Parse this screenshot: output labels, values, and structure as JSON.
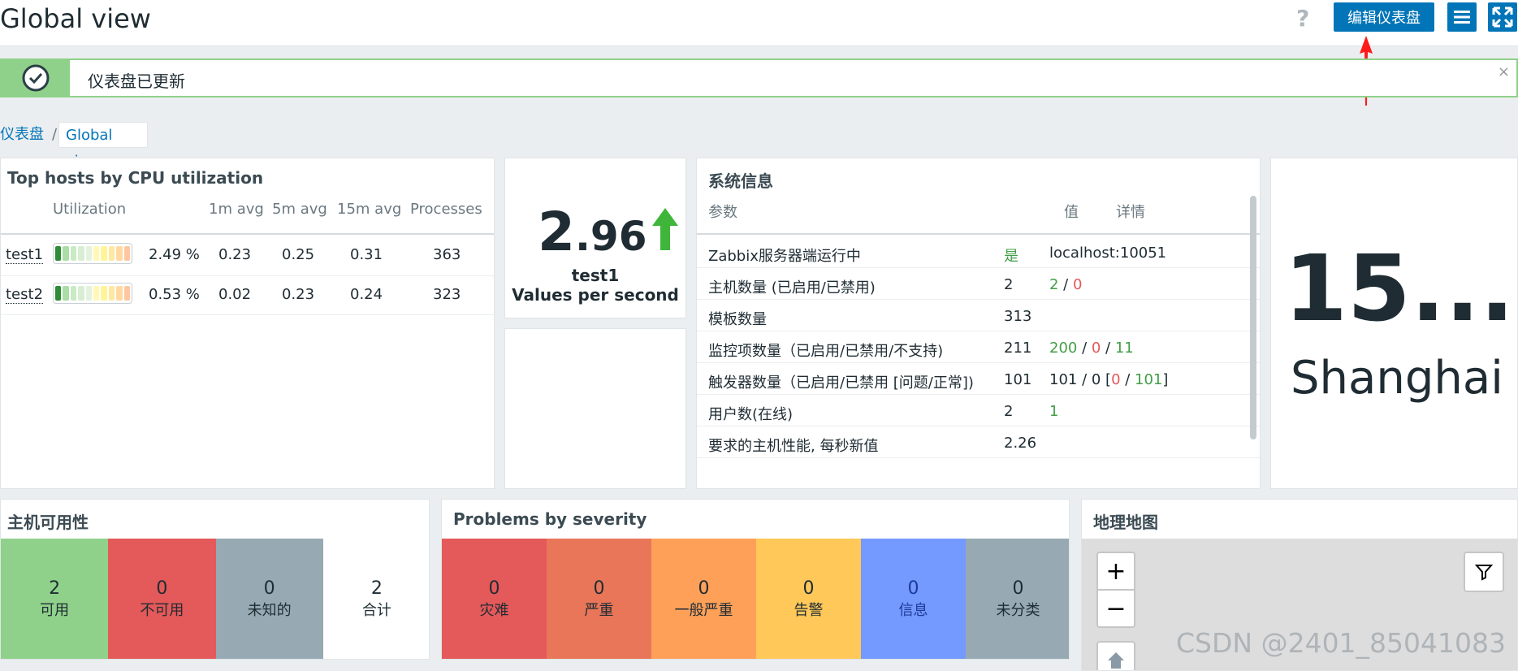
{
  "header": {
    "title": "Global view",
    "help": "?",
    "edit_button": "编辑仪表盘"
  },
  "message": {
    "text": "仪表盘已更新",
    "close": "×"
  },
  "breadcrumb": {
    "root": "仪表盘",
    "sep": "/",
    "current": "Global view"
  },
  "top_hosts": {
    "title": "Top hosts by CPU utilization",
    "columns": [
      "Utilization",
      "1m avg",
      "5m avg",
      "15m avg",
      "Processes"
    ],
    "rows": [
      {
        "host": "test1",
        "utilization": "2.49 %",
        "util_fraction": 0.025,
        "avg1": "0.23",
        "avg5": "0.25",
        "avg15": "0.31",
        "processes": "363"
      },
      {
        "host": "test2",
        "utilization": "0.53 %",
        "util_fraction": 0.005,
        "avg1": "0.02",
        "avg5": "0.23",
        "avg15": "0.24",
        "processes": "323"
      }
    ]
  },
  "item_value": {
    "value_int": "2",
    "value_dec": ".96",
    "host": "test1",
    "label": "Values per second",
    "trend_color": "#3fb63a"
  },
  "sysinfo": {
    "title": "系统信息",
    "columns": [
      "参数",
      "值",
      "详情"
    ],
    "rows": [
      {
        "param": "Zabbix服务器端运行中",
        "value": "是",
        "details": [
          "localhost:10051"
        ]
      },
      {
        "param": "主机数量 (已启用/已禁用)",
        "value": "2",
        "details": [
          "2",
          " / ",
          "0"
        ]
      },
      {
        "param": "模板数量",
        "value": "313",
        "details": []
      },
      {
        "param": "监控项数量（已启用/已禁用/不支持)",
        "value": "211",
        "details": [
          "200",
          " / ",
          "0",
          " / ",
          "11"
        ]
      },
      {
        "param": "触发器数量（已启用/已禁用 [问题/正常])",
        "value": "101",
        "details": [
          "101 / 0 [",
          "0",
          " / ",
          "101",
          "]"
        ]
      },
      {
        "param": "用户数(在线)",
        "value": "2",
        "details": [
          "1"
        ]
      },
      {
        "param": "要求的主机性能, 每秒新值",
        "value": "2.26",
        "details": []
      }
    ]
  },
  "clock": {
    "time": "15...",
    "zone": "Shanghai"
  },
  "host_availability": {
    "title": "主机可用性",
    "cells": [
      {
        "count": "2",
        "label": "可用",
        "color": "#8fd18a"
      },
      {
        "count": "0",
        "label": "不可用",
        "color": "#e45959"
      },
      {
        "count": "0",
        "label": "未知的",
        "color": "#97aab3"
      },
      {
        "count": "2",
        "label": "合计",
        "color": "#ffffff"
      }
    ]
  },
  "problems": {
    "title": "Problems by severity",
    "cells": [
      {
        "count": "0",
        "label": "灾难",
        "color": "#e45959"
      },
      {
        "count": "0",
        "label": "严重",
        "color": "#e97659"
      },
      {
        "count": "0",
        "label": "一般严重",
        "color": "#ffa059"
      },
      {
        "count": "0",
        "label": "告警",
        "color": "#ffc859"
      },
      {
        "count": "0",
        "label": "信息",
        "color": "#7499ff"
      },
      {
        "count": "0",
        "label": "未分类",
        "color": "#97aab3"
      }
    ]
  },
  "geomap": {
    "title": "地理地图",
    "zoom_in": "+",
    "zoom_out": "−"
  },
  "watermark": "CSDN @2401_85041083"
}
